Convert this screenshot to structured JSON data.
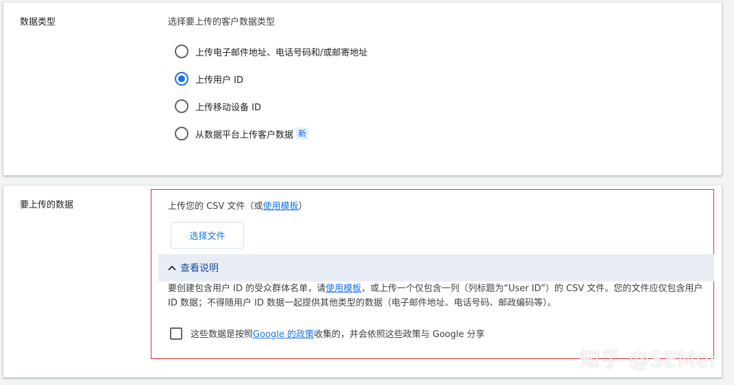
{
  "data_type": {
    "label": "数据类型",
    "title": "选择要上传的客户数据类型",
    "options": [
      {
        "label": "上传电子邮件地址、电话号码和/或邮寄地址",
        "selected": false
      },
      {
        "label": "上传用户 ID",
        "selected": true
      },
      {
        "label": "上传移动设备 ID",
        "selected": false
      },
      {
        "label": "从数据平台上传客户数据",
        "selected": false,
        "badge": "新"
      }
    ]
  },
  "upload": {
    "label": "要上传的数据",
    "prefix": "上传您的 CSV 文件（或",
    "template_link": "使用模板",
    "suffix": "）",
    "choose_button": "选择文件",
    "expander_label": "查看说明",
    "desc_part1": "要创建包含用户 ID 的受众群体名单，请",
    "desc_link": "使用模板",
    "desc_part2": "，或上传一个仅包含一列（列标题为“User ID”）的 CSV 文件。您的文件应仅包含用户 ID 数据；不得随用户 ID 数据一起提供其他类型的数据（电子邮件地址、电话号码、邮政编码等）。",
    "consent_prefix": "这些数据是按照",
    "consent_link": "Google 的政策",
    "consent_suffix": "收集的，并会依照这些政策与 Google 分享"
  },
  "watermark": "知乎 @SEMer",
  "colors": {
    "accent": "#1a73e8",
    "error": "#d93025",
    "expander_bg": "#e8edf5"
  }
}
